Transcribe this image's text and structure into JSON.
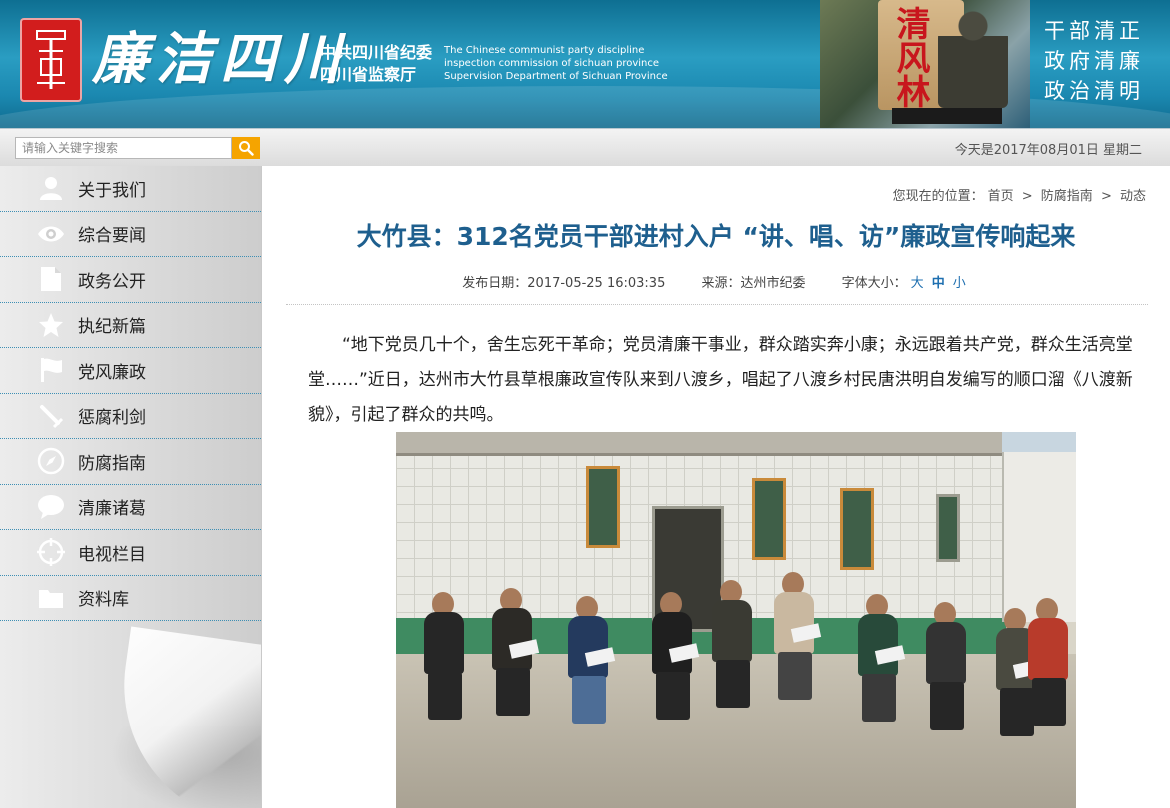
{
  "header": {
    "brand_name": "廉洁四川",
    "org_cn_line1": "中共四川省纪委",
    "org_cn_line2": "四川省监察厅",
    "org_en_line1": "The Chinese communist party discipline",
    "org_en_line2": "inspection  commission of sichuan province",
    "org_en_line3": "Supervision Department of Sichuan Province",
    "photo_sign": "清风林",
    "slogans": [
      "干部清正",
      "政府清廉",
      "政治清明"
    ]
  },
  "search": {
    "placeholder": "请输入关键字搜索"
  },
  "date_text": "今天是2017年08月01日 星期二",
  "sidebar": {
    "items": [
      {
        "label": "关于我们",
        "icon": "user-icon"
      },
      {
        "label": "综合要闻",
        "icon": "eye-icon"
      },
      {
        "label": "政务公开",
        "icon": "document-icon"
      },
      {
        "label": "执纪新篇",
        "icon": "star-icon"
      },
      {
        "label": "党风廉政",
        "icon": "flag-icon"
      },
      {
        "label": "惩腐利剑",
        "icon": "sword-icon"
      },
      {
        "label": "防腐指南",
        "icon": "compass-icon"
      },
      {
        "label": "清廉诸葛",
        "icon": "chat-icon"
      },
      {
        "label": "电视栏目",
        "icon": "target-icon"
      },
      {
        "label": "资料库",
        "icon": "folder-icon"
      }
    ]
  },
  "breadcrumb": {
    "prefix": "您现在的位置：",
    "items": [
      "首页",
      "防腐指南",
      "动态"
    ],
    "separator": ">"
  },
  "article": {
    "title": "大竹县：312名党员干部进村入户 “讲、唱、访”廉政宣传响起来",
    "publish": "发布日期：2017-05-25 16:03:35",
    "source": "来源：达州市纪委",
    "font_size_label": "字体大小：",
    "font_sizes": [
      "大",
      "中",
      "小"
    ],
    "paragraph": "“地下党员几十个，舍生忘死干革命；党员清廉干事业，群众踏实奔小康；永远跟着共产党，群众生活亮堂堂……”近日，达州市大竹县草根廉政宣传队来到八渡乡，唱起了八渡乡村民唐洪明自发编写的顺口溜《八渡新貌》，引起了群众的共鸣。"
  },
  "colors": {
    "header_blue": "#1b88b0",
    "title_blue": "#1e5f8e",
    "search_button": "#f5a400",
    "seal_red": "#d21d1d",
    "divider_blue": "#3e8fb4"
  }
}
